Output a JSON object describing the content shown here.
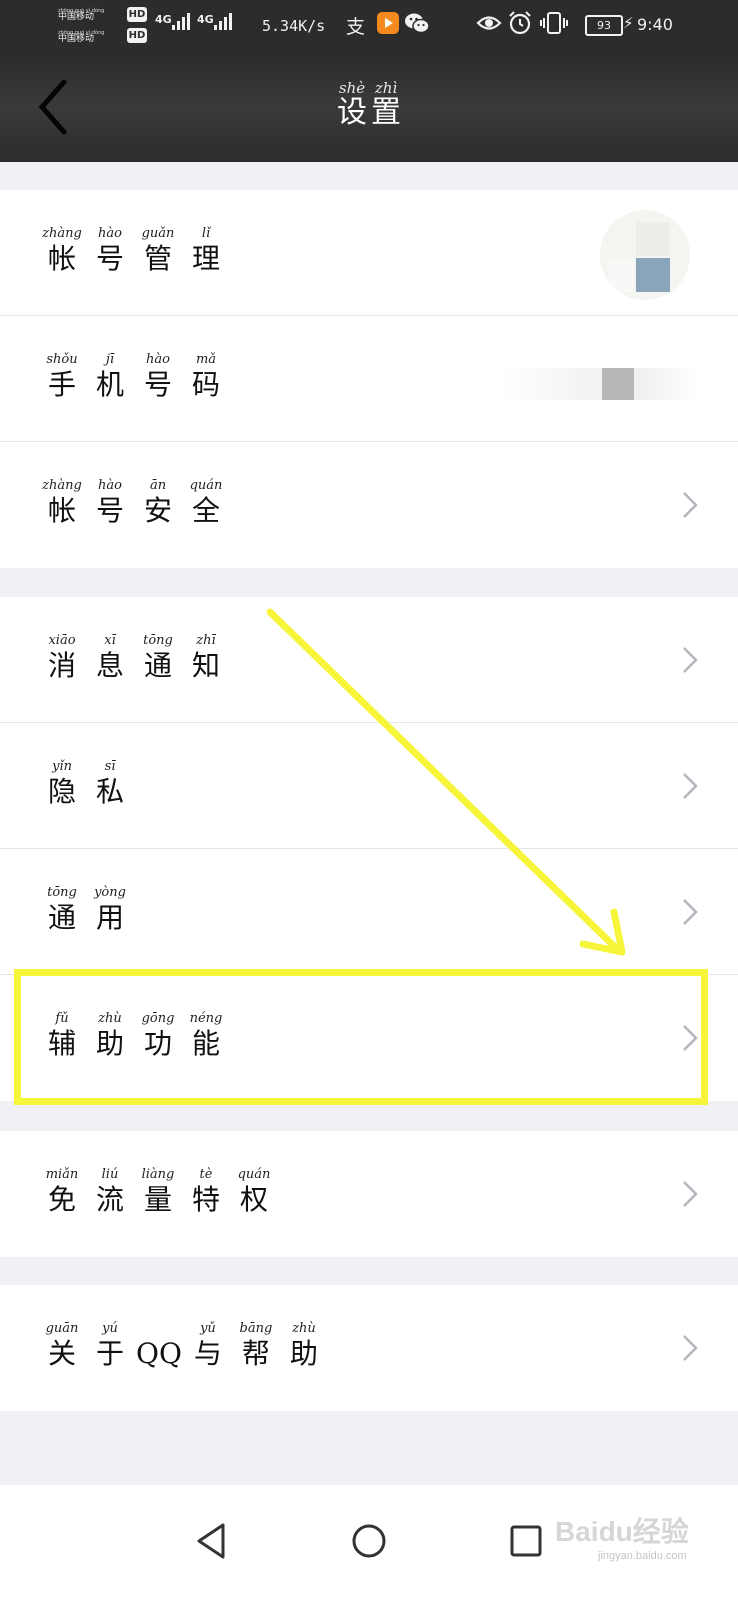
{
  "status_bar": {
    "carrier_1": "中国移动",
    "carrier_1_pinyin": "zhōng guó yí dòng",
    "carrier_2": "中国移动",
    "carrier_2_pinyin": "zhōng guó yí dòng",
    "hd_label": "HD",
    "network_1": "4G",
    "network_2": "4G",
    "speed": "5.34K/s",
    "alipay_char": "支",
    "battery_level": "93",
    "time": "9:40",
    "icons": [
      "alipay-icon",
      "video-app-icon",
      "wechat-icon",
      "eye-icon",
      "alarm-icon",
      "vibrate-icon",
      "battery-icon",
      "charging-icon"
    ]
  },
  "header": {
    "title": [
      {
        "pinyin": "shè",
        "char": "设"
      },
      {
        "pinyin": "zhì",
        "char": "置"
      }
    ],
    "back_icon": "chevron-left-icon"
  },
  "groups": [
    {
      "rows": [
        {
          "name": "account-management",
          "chars": [
            {
              "pinyin": "zhàng",
              "char": "帐"
            },
            {
              "pinyin": "hào",
              "char": "号"
            },
            {
              "pinyin": "guǎn",
              "char": "管"
            },
            {
              "pinyin": "lǐ",
              "char": "理"
            }
          ],
          "accessory": "avatar"
        },
        {
          "name": "phone-number",
          "chars": [
            {
              "pinyin": "shǒu",
              "char": "手"
            },
            {
              "pinyin": "jī",
              "char": "机"
            },
            {
              "pinyin": "hào",
              "char": "号"
            },
            {
              "pinyin": "mǎ",
              "char": "码"
            }
          ],
          "accessory": "phone"
        },
        {
          "name": "account-security",
          "chars": [
            {
              "pinyin": "zhàng",
              "char": "帐"
            },
            {
              "pinyin": "hào",
              "char": "号"
            },
            {
              "pinyin": "ān",
              "char": "安"
            },
            {
              "pinyin": "quán",
              "char": "全"
            }
          ],
          "accessory": "chevron"
        }
      ]
    },
    {
      "rows": [
        {
          "name": "message-notification",
          "chars": [
            {
              "pinyin": "xiāo",
              "char": "消"
            },
            {
              "pinyin": "xī",
              "char": "息"
            },
            {
              "pinyin": "tōng",
              "char": "通"
            },
            {
              "pinyin": "zhī",
              "char": "知"
            }
          ],
          "accessory": "chevron"
        },
        {
          "name": "privacy",
          "chars": [
            {
              "pinyin": "yǐn",
              "char": "隐"
            },
            {
              "pinyin": "sī",
              "char": "私"
            }
          ],
          "accessory": "chevron"
        },
        {
          "name": "general",
          "chars": [
            {
              "pinyin": "tōng",
              "char": "通"
            },
            {
              "pinyin": "yòng",
              "char": "用"
            }
          ],
          "accessory": "chevron"
        },
        {
          "name": "accessibility",
          "chars": [
            {
              "pinyin": "fǔ",
              "char": "辅"
            },
            {
              "pinyin": "zhù",
              "char": "助"
            },
            {
              "pinyin": "gōng",
              "char": "功"
            },
            {
              "pinyin": "néng",
              "char": "能"
            }
          ],
          "accessory": "chevron"
        }
      ]
    },
    {
      "rows": [
        {
          "name": "free-data-privilege",
          "chars": [
            {
              "pinyin": "miǎn",
              "char": "免"
            },
            {
              "pinyin": "liú",
              "char": "流"
            },
            {
              "pinyin": "liàng",
              "char": "量"
            },
            {
              "pinyin": "tè",
              "char": "特"
            },
            {
              "pinyin": "quán",
              "char": "权"
            }
          ],
          "accessory": "chevron"
        }
      ]
    },
    {
      "rows": [
        {
          "name": "about-qq-help",
          "chars": [
            {
              "pinyin": "guān",
              "char": "关"
            },
            {
              "pinyin": "yú",
              "char": "于"
            },
            {
              "pinyin": "",
              "char": "QQ"
            },
            {
              "pinyin": "yǔ",
              "char": "与"
            },
            {
              "pinyin": "bāng",
              "char": "帮"
            },
            {
              "pinyin": "zhù",
              "char": "助"
            }
          ],
          "accessory": "chevron"
        }
      ]
    }
  ],
  "annotation": {
    "highlight_color": "#f7f53a",
    "highlighted_row": "accessibility"
  },
  "nav_bar": {
    "buttons": [
      "back-triangle-icon",
      "home-circle-icon",
      "recents-square-icon"
    ]
  },
  "watermark": {
    "text": "Baidu经验",
    "sub": "jingyan.baidu.com"
  }
}
